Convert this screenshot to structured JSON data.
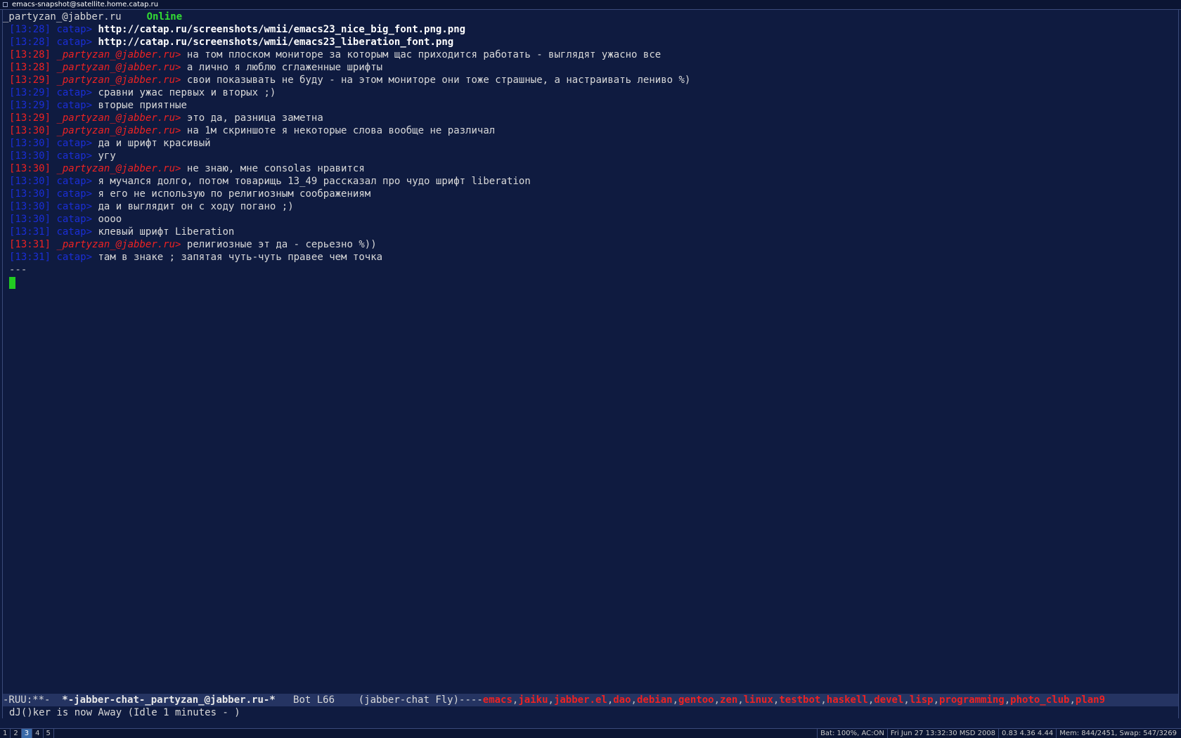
{
  "window": {
    "title": "emacs-snapshot@satellite.home.catap.ru",
    "icon": "window-icon"
  },
  "header": {
    "contact": "_partyzan_@jabber.ru",
    "status": "Online"
  },
  "chat": [
    {
      "ts": "[13:28]",
      "nick": "catap>",
      "text": "http://catap.ru/screenshots/wmii/emacs23_nice_big_font.png.png",
      "who": "them",
      "link": true
    },
    {
      "ts": "[13:28]",
      "nick": "catap>",
      "text": "http://catap.ru/screenshots/wmii/emacs23_liberation_font.png",
      "who": "them",
      "link": true
    },
    {
      "ts": "[13:28]",
      "nick": "_partyzan_@jabber.ru>",
      "text": "на том плоском мониторе за которым щас приходится работать - выглядят ужасно все",
      "who": "me"
    },
    {
      "ts": "[13:28]",
      "nick": "_partyzan_@jabber.ru>",
      "text": "а лично я люблю сглаженные шрифты",
      "who": "me"
    },
    {
      "ts": "[13:29]",
      "nick": "_partyzan_@jabber.ru>",
      "text": "свои показывать не буду - на этом мониторе они тоже страшные, а настраивать лениво %)",
      "who": "me"
    },
    {
      "ts": "[13:29]",
      "nick": "catap>",
      "text": "сравни ужас первых и вторых ;)",
      "who": "them"
    },
    {
      "ts": "[13:29]",
      "nick": "catap>",
      "text": "вторые приятные",
      "who": "them"
    },
    {
      "ts": "[13:29]",
      "nick": "_partyzan_@jabber.ru>",
      "text": "это да, разница заметна",
      "who": "me"
    },
    {
      "ts": "[13:30]",
      "nick": "_partyzan_@jabber.ru>",
      "text": "на 1м скриншоте я некоторые слова вообще не различал",
      "who": "me"
    },
    {
      "ts": "[13:30]",
      "nick": "catap>",
      "text": "да и шрифт красивый",
      "who": "them"
    },
    {
      "ts": "[13:30]",
      "nick": "catap>",
      "text": "угу",
      "who": "them"
    },
    {
      "ts": "[13:30]",
      "nick": "_partyzan_@jabber.ru>",
      "text": "не знаю, мне consolas нравится",
      "who": "me"
    },
    {
      "ts": "[13:30]",
      "nick": "catap>",
      "text": "я мучался долго, потом товарищь 13_49 рассказал про чудо шрифт liberation",
      "who": "them"
    },
    {
      "ts": "[13:30]",
      "nick": "catap>",
      "text": "я его не использую по религиозным соображениям",
      "who": "them"
    },
    {
      "ts": "[13:30]",
      "nick": "catap>",
      "text": "да и выглядит он с ходу погано ;)",
      "who": "them"
    },
    {
      "ts": "[13:30]",
      "nick": "catap>",
      "text": "оооо",
      "who": "them"
    },
    {
      "ts": "[13:31]",
      "nick": "catap>",
      "text": "клевый шрифт Liberation",
      "who": "them"
    },
    {
      "ts": "[13:31]",
      "nick": "_partyzan_@jabber.ru>",
      "text": "религиозные эт да - серьезно %))",
      "who": "me"
    },
    {
      "ts": "[13:31]",
      "nick": "catap>",
      "text": "там в знаке ; запятая чуть-чуть правее чем точка",
      "who": "them"
    }
  ],
  "separator": "---",
  "modeline": {
    "flags": "-RUU:**-  ",
    "buffer": "*-jabber-chat-_partyzan_@jabber.ru-*",
    "position": "   Bot L66    ",
    "mode": "(jabber-chat Fly)----",
    "channels": [
      "emacs",
      "jaiku",
      "jabber.el",
      "dao",
      "debian",
      "gentoo",
      "zen",
      "linux",
      "testbot",
      "haskell",
      "devel",
      "lisp",
      "programming",
      "photo_club",
      "plan9"
    ]
  },
  "echo": "dJ()ker is now Away (Idle 1 minutes - )",
  "wm": {
    "tags": [
      {
        "label": "1",
        "active": false
      },
      {
        "label": "2",
        "active": false
      },
      {
        "label": "3",
        "active": true
      },
      {
        "label": "4",
        "active": false
      },
      {
        "label": "5",
        "active": false
      }
    ],
    "status": [
      "Bat: 100%, AC:ON",
      "Fri Jun 27 13:32:30 MSD 2008",
      "0.83 4.36 4.44",
      "Mem: 844/2451, Swap: 547/3269"
    ]
  },
  "colors": {
    "background": "#0f1b40",
    "own_nick": "#ee2222",
    "other_nick": "#1a2ed6",
    "status_online": "#33dd33",
    "cursor": "#22cc22",
    "modeline_bg": "#253462"
  }
}
